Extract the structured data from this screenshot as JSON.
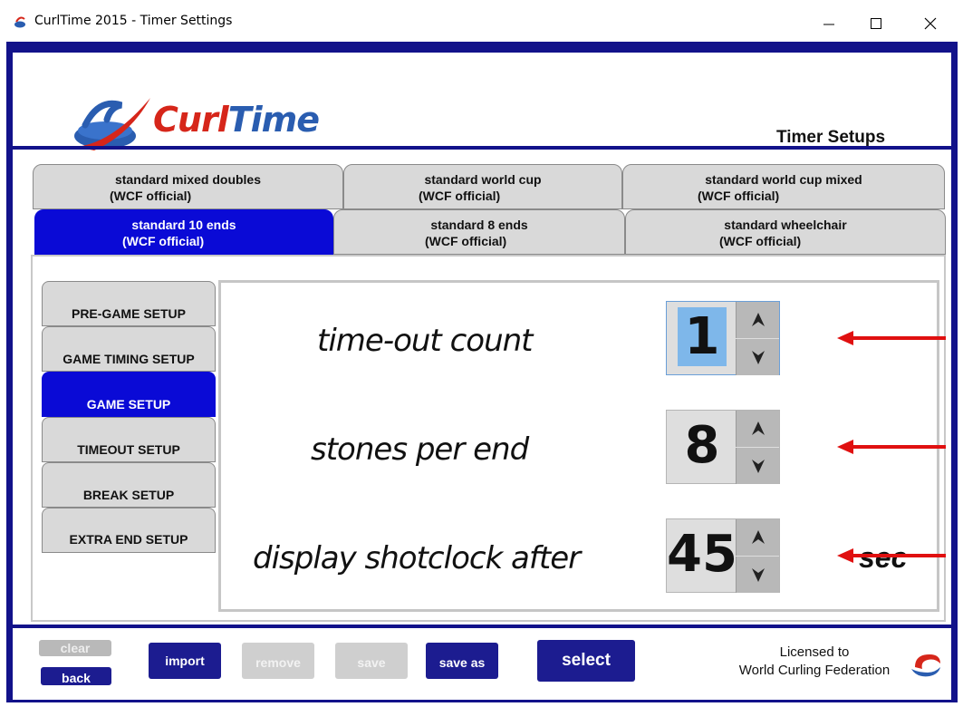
{
  "window": {
    "title": "CurlTime 2015 - Timer Settings",
    "minimize_label": "—",
    "maximize_label": "☐",
    "close_label": "✕"
  },
  "header": {
    "logo_text_1": "Curl",
    "logo_text_2": "Time",
    "page_title": "Timer Setups"
  },
  "preset_tabs": [
    {
      "line1": "standard mixed doubles",
      "line2": "(WCF official)"
    },
    {
      "line1": "standard world cup",
      "line2": "(WCF official)"
    },
    {
      "line1": "standard world cup mixed",
      "line2": "(WCF official)"
    },
    {
      "line1": "standard 10 ends",
      "line2": "(WCF official)",
      "active": true
    },
    {
      "line1": "standard 8 ends",
      "line2": "(WCF official)"
    },
    {
      "line1": "standard wheelchair",
      "line2": "(WCF official)"
    }
  ],
  "sidebar": {
    "items": [
      {
        "label": "PRE-GAME SETUP"
      },
      {
        "label": "GAME TIMING SETUP"
      },
      {
        "label": "GAME SETUP",
        "active": true
      },
      {
        "label": "TIMEOUT SETUP"
      },
      {
        "label": "BREAK SETUP"
      },
      {
        "label": "EXTRA END SETUP"
      }
    ]
  },
  "fields": [
    {
      "label": "time-out count",
      "value": "1",
      "unit": ""
    },
    {
      "label": "stones per end",
      "value": "8",
      "unit": ""
    },
    {
      "label": "display shotclock after",
      "value": "45",
      "unit": "sec"
    }
  ],
  "footer": {
    "clear_label": "clear",
    "back_label": "back",
    "import_label": "import",
    "remove_label": "remove",
    "save_label": "save",
    "save_as_label": "save as",
    "select_label": "select",
    "license_line1": "Licensed to",
    "license_line2": "World Curling Federation"
  },
  "colors": {
    "navy": "#12128a",
    "active_blue": "#0a0ad6",
    "arrow_red": "#e01010",
    "tab_grey": "#d9d9d9"
  }
}
